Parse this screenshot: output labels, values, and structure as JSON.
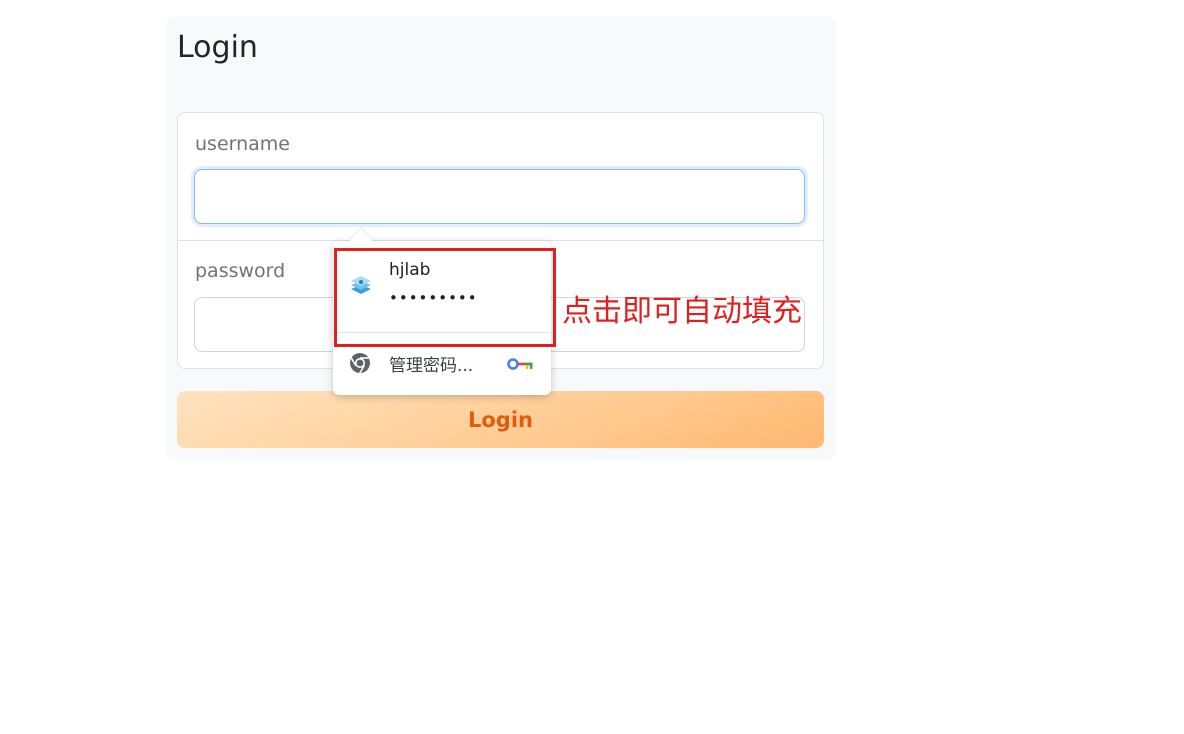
{
  "login": {
    "title": "Login",
    "username_label": "username",
    "username_value": "",
    "password_label": "password",
    "password_value": "",
    "button_label": "Login"
  },
  "autofill": {
    "suggested_username": "hjlab",
    "masked_password": "•••••••••",
    "manage_label": "管理密码...",
    "icons": [
      "site-favicon-icon",
      "chrome-icon",
      "key-icon"
    ]
  },
  "annotation": {
    "text": "点击即可自动填充",
    "color": "#e02020"
  },
  "colors": {
    "button_text": "#e25c0c",
    "button_gradient_start": "#ffe3c0",
    "button_gradient_end": "#ffb870",
    "focus_border": "#86b7fe"
  }
}
